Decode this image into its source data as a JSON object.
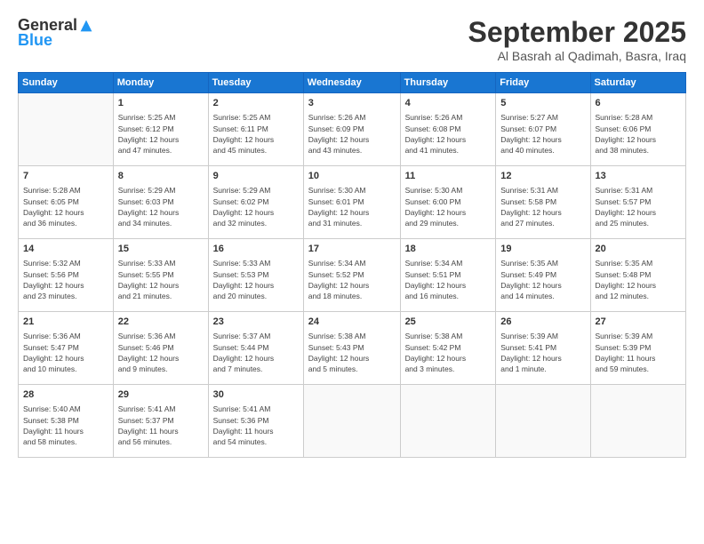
{
  "header": {
    "logo_general": "General",
    "logo_blue": "Blue",
    "month_title": "September 2025",
    "subtitle": "Al Basrah al Qadimah, Basra, Iraq"
  },
  "weekdays": [
    "Sunday",
    "Monday",
    "Tuesday",
    "Wednesday",
    "Thursday",
    "Friday",
    "Saturday"
  ],
  "weeks": [
    [
      {
        "day": "",
        "info": ""
      },
      {
        "day": "1",
        "info": "Sunrise: 5:25 AM\nSunset: 6:12 PM\nDaylight: 12 hours\nand 47 minutes."
      },
      {
        "day": "2",
        "info": "Sunrise: 5:25 AM\nSunset: 6:11 PM\nDaylight: 12 hours\nand 45 minutes."
      },
      {
        "day": "3",
        "info": "Sunrise: 5:26 AM\nSunset: 6:09 PM\nDaylight: 12 hours\nand 43 minutes."
      },
      {
        "day": "4",
        "info": "Sunrise: 5:26 AM\nSunset: 6:08 PM\nDaylight: 12 hours\nand 41 minutes."
      },
      {
        "day": "5",
        "info": "Sunrise: 5:27 AM\nSunset: 6:07 PM\nDaylight: 12 hours\nand 40 minutes."
      },
      {
        "day": "6",
        "info": "Sunrise: 5:28 AM\nSunset: 6:06 PM\nDaylight: 12 hours\nand 38 minutes."
      }
    ],
    [
      {
        "day": "7",
        "info": "Sunrise: 5:28 AM\nSunset: 6:05 PM\nDaylight: 12 hours\nand 36 minutes."
      },
      {
        "day": "8",
        "info": "Sunrise: 5:29 AM\nSunset: 6:03 PM\nDaylight: 12 hours\nand 34 minutes."
      },
      {
        "day": "9",
        "info": "Sunrise: 5:29 AM\nSunset: 6:02 PM\nDaylight: 12 hours\nand 32 minutes."
      },
      {
        "day": "10",
        "info": "Sunrise: 5:30 AM\nSunset: 6:01 PM\nDaylight: 12 hours\nand 31 minutes."
      },
      {
        "day": "11",
        "info": "Sunrise: 5:30 AM\nSunset: 6:00 PM\nDaylight: 12 hours\nand 29 minutes."
      },
      {
        "day": "12",
        "info": "Sunrise: 5:31 AM\nSunset: 5:58 PM\nDaylight: 12 hours\nand 27 minutes."
      },
      {
        "day": "13",
        "info": "Sunrise: 5:31 AM\nSunset: 5:57 PM\nDaylight: 12 hours\nand 25 minutes."
      }
    ],
    [
      {
        "day": "14",
        "info": "Sunrise: 5:32 AM\nSunset: 5:56 PM\nDaylight: 12 hours\nand 23 minutes."
      },
      {
        "day": "15",
        "info": "Sunrise: 5:33 AM\nSunset: 5:55 PM\nDaylight: 12 hours\nand 21 minutes."
      },
      {
        "day": "16",
        "info": "Sunrise: 5:33 AM\nSunset: 5:53 PM\nDaylight: 12 hours\nand 20 minutes."
      },
      {
        "day": "17",
        "info": "Sunrise: 5:34 AM\nSunset: 5:52 PM\nDaylight: 12 hours\nand 18 minutes."
      },
      {
        "day": "18",
        "info": "Sunrise: 5:34 AM\nSunset: 5:51 PM\nDaylight: 12 hours\nand 16 minutes."
      },
      {
        "day": "19",
        "info": "Sunrise: 5:35 AM\nSunset: 5:49 PM\nDaylight: 12 hours\nand 14 minutes."
      },
      {
        "day": "20",
        "info": "Sunrise: 5:35 AM\nSunset: 5:48 PM\nDaylight: 12 hours\nand 12 minutes."
      }
    ],
    [
      {
        "day": "21",
        "info": "Sunrise: 5:36 AM\nSunset: 5:47 PM\nDaylight: 12 hours\nand 10 minutes."
      },
      {
        "day": "22",
        "info": "Sunrise: 5:36 AM\nSunset: 5:46 PM\nDaylight: 12 hours\nand 9 minutes."
      },
      {
        "day": "23",
        "info": "Sunrise: 5:37 AM\nSunset: 5:44 PM\nDaylight: 12 hours\nand 7 minutes."
      },
      {
        "day": "24",
        "info": "Sunrise: 5:38 AM\nSunset: 5:43 PM\nDaylight: 12 hours\nand 5 minutes."
      },
      {
        "day": "25",
        "info": "Sunrise: 5:38 AM\nSunset: 5:42 PM\nDaylight: 12 hours\nand 3 minutes."
      },
      {
        "day": "26",
        "info": "Sunrise: 5:39 AM\nSunset: 5:41 PM\nDaylight: 12 hours\nand 1 minute."
      },
      {
        "day": "27",
        "info": "Sunrise: 5:39 AM\nSunset: 5:39 PM\nDaylight: 11 hours\nand 59 minutes."
      }
    ],
    [
      {
        "day": "28",
        "info": "Sunrise: 5:40 AM\nSunset: 5:38 PM\nDaylight: 11 hours\nand 58 minutes."
      },
      {
        "day": "29",
        "info": "Sunrise: 5:41 AM\nSunset: 5:37 PM\nDaylight: 11 hours\nand 56 minutes."
      },
      {
        "day": "30",
        "info": "Sunrise: 5:41 AM\nSunset: 5:36 PM\nDaylight: 11 hours\nand 54 minutes."
      },
      {
        "day": "",
        "info": ""
      },
      {
        "day": "",
        "info": ""
      },
      {
        "day": "",
        "info": ""
      },
      {
        "day": "",
        "info": ""
      }
    ]
  ]
}
